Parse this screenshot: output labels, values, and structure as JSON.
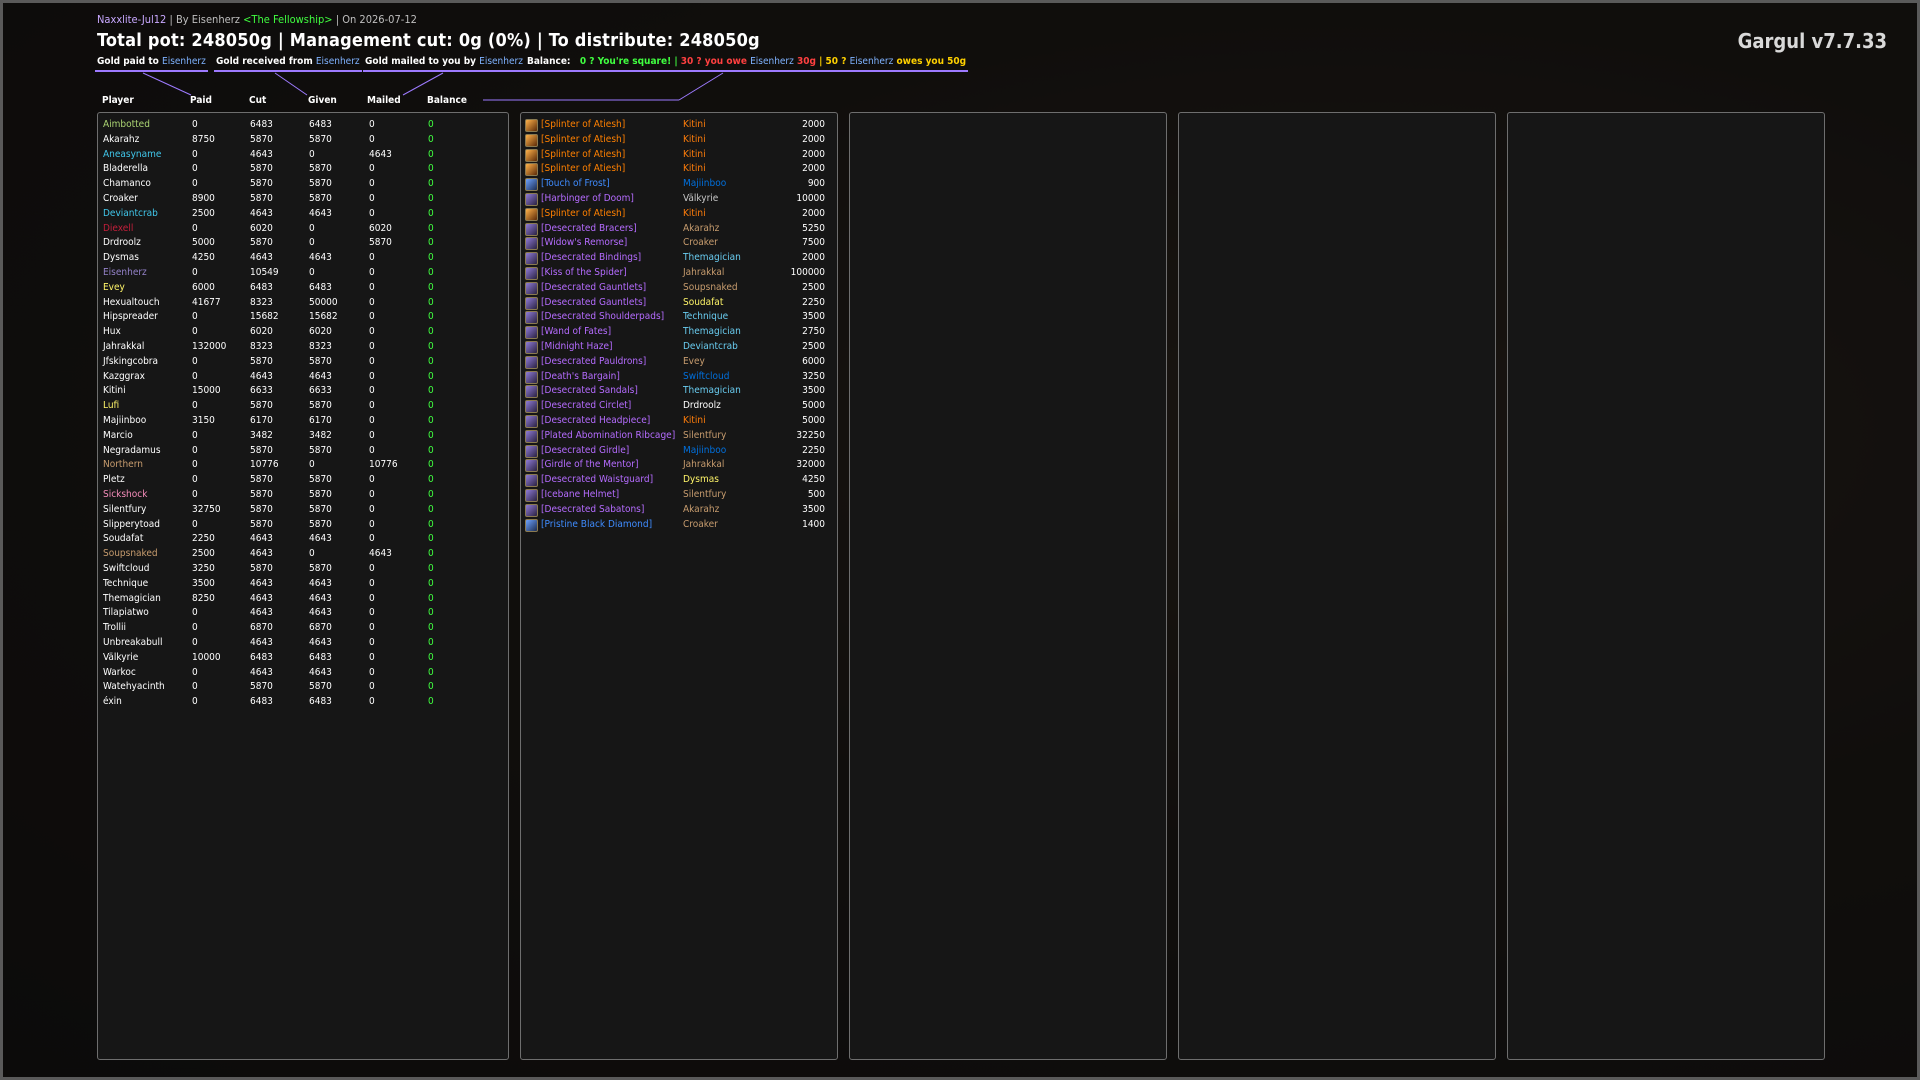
{
  "header": {
    "raid_name": "Naxxlite-Jul12",
    "by_text": "By Eisenherz",
    "guild": "<The Fellowship>",
    "date_text": "On 2026-07-12",
    "sep": "|",
    "title": "Total pot: 248050g | Management cut: 0g (0%) | To distribute: 248050g",
    "brand": "Gargul v7.7.33"
  },
  "legend": {
    "paid_label": "Gold paid to",
    "paid_name": "Eisenherz",
    "received_label": "Gold received from",
    "received_name": "Eisenherz",
    "mailed_label": "Gold mailed to you by",
    "mailed_name": "Eisenherz",
    "balance_label": "Balance:",
    "square_text": "0 ? You're square!",
    "sep": "|",
    "owe_prefix": "30 ? you owe",
    "owe_name": "Eisenherz",
    "owe_amount": "30g",
    "owes_prefix": "50 ?",
    "owes_name": "Eisenherz",
    "owes_suffix": "owes you 50g"
  },
  "columns": {
    "player": "Player",
    "paid": "Paid",
    "cut": "Cut",
    "given": "Given",
    "mailed": "Mailed",
    "balance": "Balance"
  },
  "colors": {
    "accent": "#9d7aff",
    "green": "#40ff40",
    "red": "#ff4040",
    "gold": "#ffd100",
    "epic": "#a335ee",
    "rare": "#0070dd",
    "legendary": "#ff8000"
  },
  "players": [
    {
      "name": "Aimbotted",
      "color": "#abd473",
      "paid": "0",
      "cut": "6483",
      "given": "6483",
      "mailed": "0",
      "balance": "0"
    },
    {
      "name": "Akarahz",
      "color": "#ffffff",
      "paid": "8750",
      "cut": "5870",
      "given": "5870",
      "mailed": "0",
      "balance": "0"
    },
    {
      "name": "Aneasyname",
      "color": "#40c7eb",
      "paid": "0",
      "cut": "4643",
      "given": "0",
      "mailed": "4643",
      "balance": "0"
    },
    {
      "name": "Bladerella",
      "color": "#ffffff",
      "paid": "0",
      "cut": "5870",
      "given": "5870",
      "mailed": "0",
      "balance": "0"
    },
    {
      "name": "Chamanco",
      "color": "#ffffff",
      "paid": "0",
      "cut": "5870",
      "given": "5870",
      "mailed": "0",
      "balance": "0"
    },
    {
      "name": "Croaker",
      "color": "#ffffff",
      "paid": "8900",
      "cut": "5870",
      "given": "5870",
      "mailed": "0",
      "balance": "0"
    },
    {
      "name": "Deviantcrab",
      "color": "#40c7eb",
      "paid": "2500",
      "cut": "4643",
      "given": "4643",
      "mailed": "0",
      "balance": "0"
    },
    {
      "name": "Diexell",
      "color": "#c41f3b",
      "paid": "0",
      "cut": "6020",
      "given": "0",
      "mailed": "6020",
      "balance": "0"
    },
    {
      "name": "Drdroolz",
      "color": "#ffffff",
      "paid": "5000",
      "cut": "5870",
      "given": "0",
      "mailed": "5870",
      "balance": "0"
    },
    {
      "name": "Dysmas",
      "color": "#ffffff",
      "paid": "4250",
      "cut": "4643",
      "given": "4643",
      "mailed": "0",
      "balance": "0"
    },
    {
      "name": "Eisenherz",
      "color": "#9482c9",
      "paid": "0",
      "cut": "10549",
      "given": "0",
      "mailed": "0",
      "balance": "0"
    },
    {
      "name": "Evey",
      "color": "#fff569",
      "paid": "6000",
      "cut": "6483",
      "given": "6483",
      "mailed": "0",
      "balance": "0"
    },
    {
      "name": "Hexualtouch",
      "color": "#ffffff",
      "paid": "41677",
      "cut": "8323",
      "given": "50000",
      "mailed": "0",
      "balance": "0"
    },
    {
      "name": "Hipspreader",
      "color": "#ffffff",
      "paid": "0",
      "cut": "15682",
      "given": "15682",
      "mailed": "0",
      "balance": "0"
    },
    {
      "name": "Hux",
      "color": "#ffffff",
      "paid": "0",
      "cut": "6020",
      "given": "6020",
      "mailed": "0",
      "balance": "0"
    },
    {
      "name": "Jahrakkal",
      "color": "#ffffff",
      "paid": "132000",
      "cut": "8323",
      "given": "8323",
      "mailed": "0",
      "balance": "0"
    },
    {
      "name": "Jfskingcobra",
      "color": "#ffffff",
      "paid": "0",
      "cut": "5870",
      "given": "5870",
      "mailed": "0",
      "balance": "0"
    },
    {
      "name": "Kazggrax",
      "color": "#ffffff",
      "paid": "0",
      "cut": "4643",
      "given": "4643",
      "mailed": "0",
      "balance": "0"
    },
    {
      "name": "Kitini",
      "color": "#ffffff",
      "paid": "15000",
      "cut": "6633",
      "given": "6633",
      "mailed": "0",
      "balance": "0"
    },
    {
      "name": "Lufi",
      "color": "#fff569",
      "paid": "0",
      "cut": "5870",
      "given": "5870",
      "mailed": "0",
      "balance": "0"
    },
    {
      "name": "Majiinboo",
      "color": "#ffffff",
      "paid": "3150",
      "cut": "6170",
      "given": "6170",
      "mailed": "0",
      "balance": "0"
    },
    {
      "name": "Marcio",
      "color": "#ffffff",
      "paid": "0",
      "cut": "3482",
      "given": "3482",
      "mailed": "0",
      "balance": "0"
    },
    {
      "name": "Negradamus",
      "color": "#ffffff",
      "paid": "0",
      "cut": "5870",
      "given": "5870",
      "mailed": "0",
      "balance": "0"
    },
    {
      "name": "Northern",
      "color": "#c79c6e",
      "paid": "0",
      "cut": "10776",
      "given": "0",
      "mailed": "10776",
      "balance": "0"
    },
    {
      "name": "Pletz",
      "color": "#ffffff",
      "paid": "0",
      "cut": "5870",
      "given": "5870",
      "mailed": "0",
      "balance": "0"
    },
    {
      "name": "Sickshock",
      "color": "#f58cba",
      "paid": "0",
      "cut": "5870",
      "given": "5870",
      "mailed": "0",
      "balance": "0"
    },
    {
      "name": "Silentfury",
      "color": "#ffffff",
      "paid": "32750",
      "cut": "5870",
      "given": "5870",
      "mailed": "0",
      "balance": "0"
    },
    {
      "name": "Slipperytoad",
      "color": "#ffffff",
      "paid": "0",
      "cut": "5870",
      "given": "5870",
      "mailed": "0",
      "balance": "0"
    },
    {
      "name": "Soudafat",
      "color": "#ffffff",
      "paid": "2250",
      "cut": "4643",
      "given": "4643",
      "mailed": "0",
      "balance": "0"
    },
    {
      "name": "Soupsnaked",
      "color": "#c79c6e",
      "paid": "2500",
      "cut": "4643",
      "given": "0",
      "mailed": "4643",
      "balance": "0"
    },
    {
      "name": "Swiftcloud",
      "color": "#ffffff",
      "paid": "3250",
      "cut": "5870",
      "given": "5870",
      "mailed": "0",
      "balance": "0"
    },
    {
      "name": "Technique",
      "color": "#ffffff",
      "paid": "3500",
      "cut": "4643",
      "given": "4643",
      "mailed": "0",
      "balance": "0"
    },
    {
      "name": "Themagician",
      "color": "#ffffff",
      "paid": "8250",
      "cut": "4643",
      "given": "4643",
      "mailed": "0",
      "balance": "0"
    },
    {
      "name": "Tilapiatwo",
      "color": "#ffffff",
      "paid": "0",
      "cut": "4643",
      "given": "4643",
      "mailed": "0",
      "balance": "0"
    },
    {
      "name": "Trollii",
      "color": "#ffffff",
      "paid": "0",
      "cut": "6870",
      "given": "6870",
      "mailed": "0",
      "balance": "0"
    },
    {
      "name": "Unbreakabull",
      "color": "#ffffff",
      "paid": "0",
      "cut": "4643",
      "given": "4643",
      "mailed": "0",
      "balance": "0"
    },
    {
      "name": "Välkyrie",
      "color": "#ffffff",
      "paid": "10000",
      "cut": "6483",
      "given": "6483",
      "mailed": "0",
      "balance": "0"
    },
    {
      "name": "Warkoc",
      "color": "#ffffff",
      "paid": "0",
      "cut": "4643",
      "given": "4643",
      "mailed": "0",
      "balance": "0"
    },
    {
      "name": "Watehyacinth",
      "color": "#ffffff",
      "paid": "0",
      "cut": "5870",
      "given": "5870",
      "mailed": "0",
      "balance": "0"
    },
    {
      "name": "éxin",
      "color": "#ffffff",
      "paid": "0",
      "cut": "6483",
      "given": "6483",
      "mailed": "0",
      "balance": "0"
    }
  ],
  "items": [
    {
      "icon": "splinter-icon",
      "item": "[Splinter of Atiesh]",
      "quality": "legend",
      "winner": "Kitini",
      "winner_color": "#ff7d0a",
      "price": "2000"
    },
    {
      "icon": "splinter-icon",
      "item": "[Splinter of Atiesh]",
      "quality": "legend",
      "winner": "Kitini",
      "winner_color": "#ff7d0a",
      "price": "2000"
    },
    {
      "icon": "splinter-icon",
      "item": "[Splinter of Atiesh]",
      "quality": "legend",
      "winner": "Kitini",
      "winner_color": "#ff7d0a",
      "price": "2000"
    },
    {
      "icon": "splinter-icon",
      "item": "[Splinter of Atiesh]",
      "quality": "legend",
      "winner": "Kitini",
      "winner_color": "#ff7d0a",
      "price": "2000"
    },
    {
      "icon": "frost-icon",
      "item": "[Touch of Frost]",
      "quality": "rare",
      "winner": "Majiinboo",
      "winner_color": "#0070de",
      "price": "900"
    },
    {
      "icon": "weapon-icon",
      "item": "[Harbinger of Doom]",
      "quality": "epic",
      "winner": "Välkyrie",
      "winner_color": "#c7c7c7",
      "price": "10000"
    },
    {
      "icon": "splinter-icon",
      "item": "[Splinter of Atiesh]",
      "quality": "legend",
      "winner": "Kitini",
      "winner_color": "#ff7d0a",
      "price": "2000"
    },
    {
      "icon": "bracers-icon",
      "item": "[Desecrated Bracers]",
      "quality": "epic",
      "winner": "Akarahz",
      "winner_color": "#c79c6e",
      "price": "5250"
    },
    {
      "icon": "trinket-icon",
      "item": "[Widow's Remorse]",
      "quality": "epic",
      "winner": "Croaker",
      "winner_color": "#c79c6e",
      "price": "7500"
    },
    {
      "icon": "bindings-icon",
      "item": "[Desecrated Bindings]",
      "quality": "epic",
      "winner": "Themagician",
      "winner_color": "#69ccf0",
      "price": "2000"
    },
    {
      "icon": "ring-icon",
      "item": "[Kiss of the Spider]",
      "quality": "epic",
      "winner": "Jahrakkal",
      "winner_color": "#c79c6e",
      "price": "100000"
    },
    {
      "icon": "gauntlets-icon",
      "item": "[Desecrated Gauntlets]",
      "quality": "epic",
      "winner": "Soupsnaked",
      "winner_color": "#c79c6e",
      "price": "2500"
    },
    {
      "icon": "gauntlets-icon",
      "item": "[Desecrated Gauntlets]",
      "quality": "epic",
      "winner": "Soudafat",
      "winner_color": "#fff569",
      "price": "2250"
    },
    {
      "icon": "shoulder-icon",
      "item": "[Desecrated Shoulderpads]",
      "quality": "epic",
      "winner": "Technique",
      "winner_color": "#69ccf0",
      "price": "3500"
    },
    {
      "icon": "wand-icon",
      "item": "[Wand of Fates]",
      "quality": "epic",
      "winner": "Themagician",
      "winner_color": "#69ccf0",
      "price": "2750"
    },
    {
      "icon": "ring-icon",
      "item": "[Midnight Haze]",
      "quality": "epic",
      "winner": "Deviantcrab",
      "winner_color": "#69ccf0",
      "price": "2500"
    },
    {
      "icon": "pauldrons-icon",
      "item": "[Desecrated Pauldrons]",
      "quality": "epic",
      "winner": "Evey",
      "winner_color": "#c79c6e",
      "price": "6000"
    },
    {
      "icon": "trinket-icon",
      "item": "[Death's Bargain]",
      "quality": "epic",
      "winner": "Swiftcloud",
      "winner_color": "#0070de",
      "price": "3250"
    },
    {
      "icon": "sandals-icon",
      "item": "[Desecrated Sandals]",
      "quality": "epic",
      "winner": "Themagician",
      "winner_color": "#69ccf0",
      "price": "3500"
    },
    {
      "icon": "circlet-icon",
      "item": "[Desecrated Circlet]",
      "quality": "epic",
      "winner": "Drdroolz",
      "winner_color": "#ffffff",
      "price": "5000"
    },
    {
      "icon": "headpiece-icon",
      "item": "[Desecrated Headpiece]",
      "quality": "epic",
      "winner": "Kitini",
      "winner_color": "#ff7d0a",
      "price": "5000"
    },
    {
      "icon": "chest-icon",
      "item": "[Plated Abomination Ribcage]",
      "quality": "epic",
      "winner": "Silentfury",
      "winner_color": "#c79c6e",
      "price": "32250"
    },
    {
      "icon": "girdle-icon",
      "item": "[Desecrated Girdle]",
      "quality": "epic",
      "winner": "Majiinboo",
      "winner_color": "#0070de",
      "price": "2250"
    },
    {
      "icon": "girdle-icon",
      "item": "[Girdle of the Mentor]",
      "quality": "epic",
      "winner": "Jahrakkal",
      "winner_color": "#c79c6e",
      "price": "32000"
    },
    {
      "icon": "waist-icon",
      "item": "[Desecrated Waistguard]",
      "quality": "epic",
      "winner": "Dysmas",
      "winner_color": "#fff569",
      "price": "4250"
    },
    {
      "icon": "helmet-icon",
      "item": "[Icebane Helmet]",
      "quality": "epic",
      "winner": "Silentfury",
      "winner_color": "#c79c6e",
      "price": "500"
    },
    {
      "icon": "sabatons-icon",
      "item": "[Desecrated Sabatons]",
      "quality": "epic",
      "winner": "Akarahz",
      "winner_color": "#c79c6e",
      "price": "3500"
    },
    {
      "icon": "diamond-icon",
      "item": "[Pristine Black Diamond]",
      "quality": "rare",
      "winner": "Croaker",
      "winner_color": "#c79c6e",
      "price": "1400"
    }
  ]
}
